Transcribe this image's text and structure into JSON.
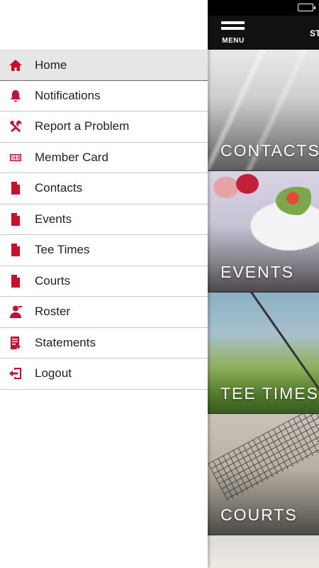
{
  "colors": {
    "accent": "#c8102e",
    "drawer_bg": "#ffffff",
    "active_bg": "#e6e6e6"
  },
  "topbar": {
    "menu_label": "MENU",
    "title": "ST"
  },
  "tiles": [
    {
      "label": "CONTACTS"
    },
    {
      "label": "EVENTS"
    },
    {
      "label": "TEE TIMES"
    },
    {
      "label": "COURTS"
    }
  ],
  "menu": {
    "items": [
      {
        "label": "Home",
        "icon": "home-icon"
      },
      {
        "label": "Notifications",
        "icon": "bell-icon"
      },
      {
        "label": "Report a Problem",
        "icon": "tools-icon"
      },
      {
        "label": "Member Card",
        "icon": "barcode-icon"
      },
      {
        "label": "Contacts",
        "icon": "document-icon"
      },
      {
        "label": "Events",
        "icon": "document-icon"
      },
      {
        "label": "Tee Times",
        "icon": "document-icon"
      },
      {
        "label": "Courts",
        "icon": "document-icon"
      },
      {
        "label": "Roster",
        "icon": "person-icon"
      },
      {
        "label": "Statements",
        "icon": "statement-icon"
      },
      {
        "label": "Logout",
        "icon": "logout-icon"
      }
    ]
  }
}
